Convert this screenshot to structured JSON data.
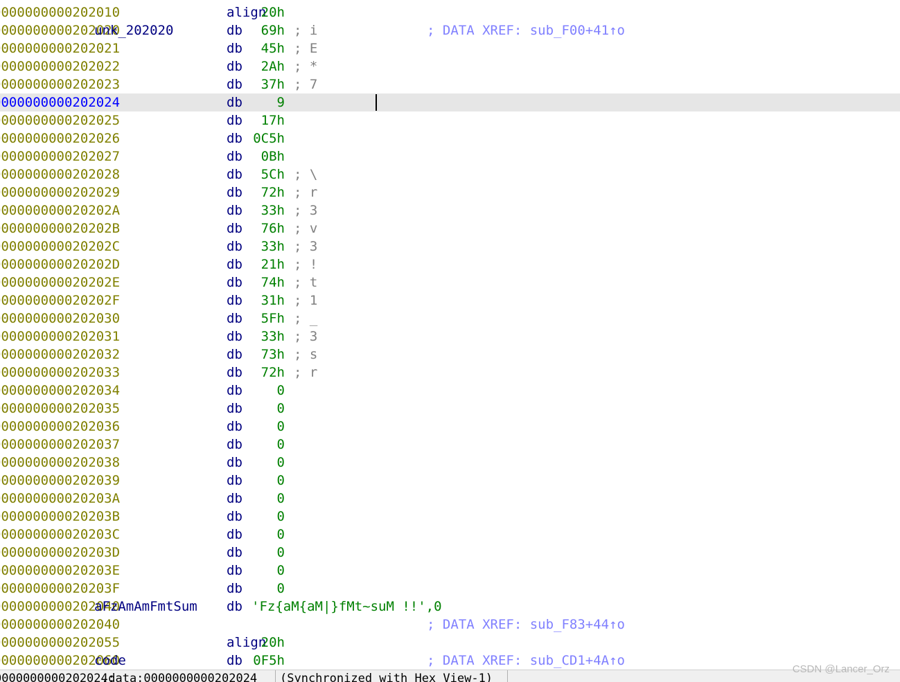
{
  "listing": {
    "rows": [
      {
        "addr": "0000000000202010",
        "label": "",
        "mnem": "align",
        "operand": "20h",
        "comment": "",
        "xref": ""
      },
      {
        "addr": "0000000000202020",
        "label": "unk_202020",
        "mnem": "db",
        "operand": "69h",
        "comment": "; i",
        "xref": "; DATA XREF: sub_F00+41↑o"
      },
      {
        "addr": "0000000000202021",
        "label": "",
        "mnem": "db",
        "operand": "45h",
        "comment": "; E",
        "xref": ""
      },
      {
        "addr": "0000000000202022",
        "label": "",
        "mnem": "db",
        "operand": "2Ah",
        "comment": "; *",
        "xref": ""
      },
      {
        "addr": "0000000000202023",
        "label": "",
        "mnem": "db",
        "operand": "37h",
        "comment": "; 7",
        "xref": ""
      },
      {
        "addr": "0000000000202024",
        "label": "",
        "mnem": "db",
        "operand": "9",
        "comment": "",
        "xref": ""
      },
      {
        "addr": "0000000000202025",
        "label": "",
        "mnem": "db",
        "operand": "17h",
        "comment": "",
        "xref": ""
      },
      {
        "addr": "0000000000202026",
        "label": "",
        "mnem": "db",
        "operand": "0C5h",
        "comment": "",
        "xref": ""
      },
      {
        "addr": "0000000000202027",
        "label": "",
        "mnem": "db",
        "operand": "0Bh",
        "comment": "",
        "xref": ""
      },
      {
        "addr": "0000000000202028",
        "label": "",
        "mnem": "db",
        "operand": "5Ch",
        "comment": "; \\",
        "xref": ""
      },
      {
        "addr": "0000000000202029",
        "label": "",
        "mnem": "db",
        "operand": "72h",
        "comment": "; r",
        "xref": ""
      },
      {
        "addr": "000000000020202A",
        "label": "",
        "mnem": "db",
        "operand": "33h",
        "comment": "; 3",
        "xref": ""
      },
      {
        "addr": "000000000020202B",
        "label": "",
        "mnem": "db",
        "operand": "76h",
        "comment": "; v",
        "xref": ""
      },
      {
        "addr": "000000000020202C",
        "label": "",
        "mnem": "db",
        "operand": "33h",
        "comment": "; 3",
        "xref": ""
      },
      {
        "addr": "000000000020202D",
        "label": "",
        "mnem": "db",
        "operand": "21h",
        "comment": "; !",
        "xref": ""
      },
      {
        "addr": "000000000020202E",
        "label": "",
        "mnem": "db",
        "operand": "74h",
        "comment": "; t",
        "xref": ""
      },
      {
        "addr": "000000000020202F",
        "label": "",
        "mnem": "db",
        "operand": "31h",
        "comment": "; 1",
        "xref": ""
      },
      {
        "addr": "0000000000202030",
        "label": "",
        "mnem": "db",
        "operand": "5Fh",
        "comment": "; _",
        "xref": ""
      },
      {
        "addr": "0000000000202031",
        "label": "",
        "mnem": "db",
        "operand": "33h",
        "comment": "; 3",
        "xref": ""
      },
      {
        "addr": "0000000000202032",
        "label": "",
        "mnem": "db",
        "operand": "73h",
        "comment": "; s",
        "xref": ""
      },
      {
        "addr": "0000000000202033",
        "label": "",
        "mnem": "db",
        "operand": "72h",
        "comment": "; r",
        "xref": ""
      },
      {
        "addr": "0000000000202034",
        "label": "",
        "mnem": "db",
        "operand": "0",
        "comment": "",
        "xref": ""
      },
      {
        "addr": "0000000000202035",
        "label": "",
        "mnem": "db",
        "operand": "0",
        "comment": "",
        "xref": ""
      },
      {
        "addr": "0000000000202036",
        "label": "",
        "mnem": "db",
        "operand": "0",
        "comment": "",
        "xref": ""
      },
      {
        "addr": "0000000000202037",
        "label": "",
        "mnem": "db",
        "operand": "0",
        "comment": "",
        "xref": ""
      },
      {
        "addr": "0000000000202038",
        "label": "",
        "mnem": "db",
        "operand": "0",
        "comment": "",
        "xref": ""
      },
      {
        "addr": "0000000000202039",
        "label": "",
        "mnem": "db",
        "operand": "0",
        "comment": "",
        "xref": ""
      },
      {
        "addr": "000000000020203A",
        "label": "",
        "mnem": "db",
        "operand": "0",
        "comment": "",
        "xref": ""
      },
      {
        "addr": "000000000020203B",
        "label": "",
        "mnem": "db",
        "operand": "0",
        "comment": "",
        "xref": ""
      },
      {
        "addr": "000000000020203C",
        "label": "",
        "mnem": "db",
        "operand": "0",
        "comment": "",
        "xref": ""
      },
      {
        "addr": "000000000020203D",
        "label": "",
        "mnem": "db",
        "operand": "0",
        "comment": "",
        "xref": ""
      },
      {
        "addr": "000000000020203E",
        "label": "",
        "mnem": "db",
        "operand": "0",
        "comment": "",
        "xref": ""
      },
      {
        "addr": "000000000020203F",
        "label": "",
        "mnem": "db",
        "operand": "0",
        "comment": "",
        "xref": ""
      },
      {
        "addr": "0000000000202040",
        "label": "aFzAmAmFmtSum",
        "mnem": "db",
        "operand": "'Fz{aM{aM|}fMt~suM !!',0",
        "comment": "",
        "xref": ""
      },
      {
        "addr": "0000000000202040",
        "label": "",
        "mnem": "",
        "operand": "",
        "comment": "",
        "xref": "; DATA XREF: sub_F83+44↑o"
      },
      {
        "addr": "0000000000202055",
        "label": "",
        "mnem": "align",
        "operand": "20h",
        "comment": "",
        "xref": ""
      },
      {
        "addr": "0000000000202060",
        "label": "code",
        "mnem": "db",
        "operand": "0F5h",
        "comment": "",
        "xref": "; DATA XREF: sub_CD1+4A↑o"
      }
    ]
  },
  "statusbar": {
    "offset": "0000000000202024:",
    "location": ".data:0000000000202024",
    "sync": "(Synchronized with Hex View-1)"
  },
  "watermark": "CSDN @Lancer_Orz"
}
